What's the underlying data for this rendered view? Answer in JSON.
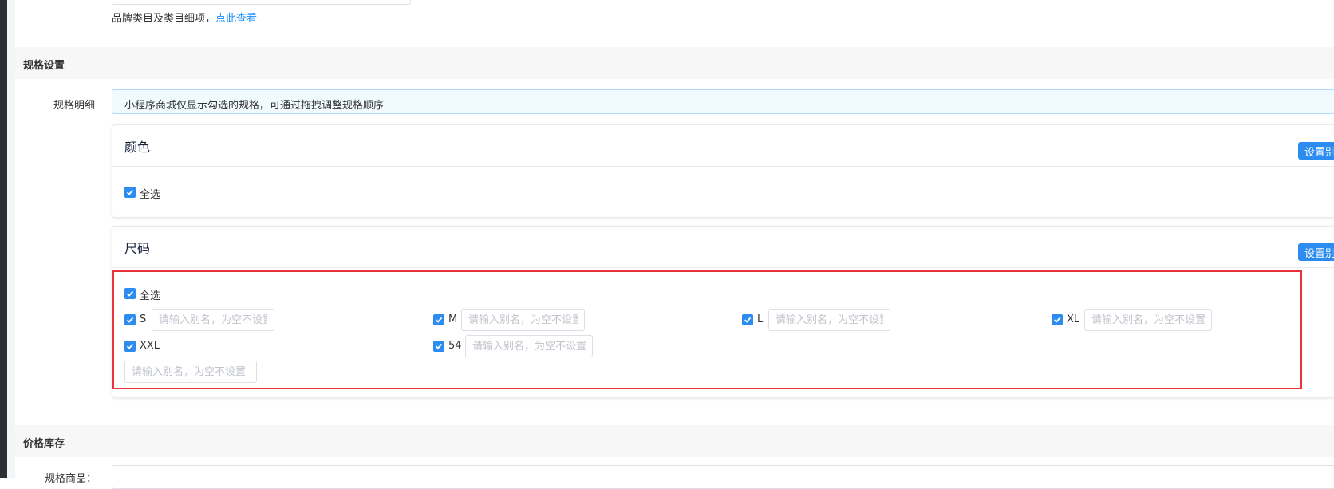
{
  "brand": {
    "hint_text": "品牌类目及类目细项，",
    "hint_link": "点此查看"
  },
  "spec_section": {
    "title": "规格设置",
    "detail_label": "规格明细",
    "notice": "小程序商城仅显示勾选的规格，可通过拖拽调整规格顺序",
    "groups": [
      {
        "name": "颜色",
        "alias_button": "设置别名",
        "select_all": "全选",
        "select_all_checked": true
      },
      {
        "name": "尺码",
        "alias_button": "设置别名",
        "select_all": "全选",
        "select_all_checked": true,
        "options": [
          {
            "label": "S",
            "checked": true,
            "placeholder": "请输入别名，为空不设置"
          },
          {
            "label": "M",
            "checked": true,
            "placeholder": "请输入别名，为空不设置"
          },
          {
            "label": "L",
            "checked": true,
            "placeholder": "请输入别名，为空不设置"
          },
          {
            "label": "XL",
            "checked": true,
            "placeholder": "请输入别名，为空不设置"
          },
          {
            "label": "XXL",
            "checked": true,
            "placeholder": "请输入别名，为空不设置"
          },
          {
            "label": "54",
            "checked": true,
            "placeholder": "请输入别名，为空不设置"
          }
        ]
      }
    ]
  },
  "price_section": {
    "title": "价格库存",
    "first_label": "规格商品："
  },
  "colors": {
    "primary": "#2d8cf0",
    "link": "#1890ff",
    "highlight": "#e8343a",
    "notice_bg": "#f0faff"
  }
}
